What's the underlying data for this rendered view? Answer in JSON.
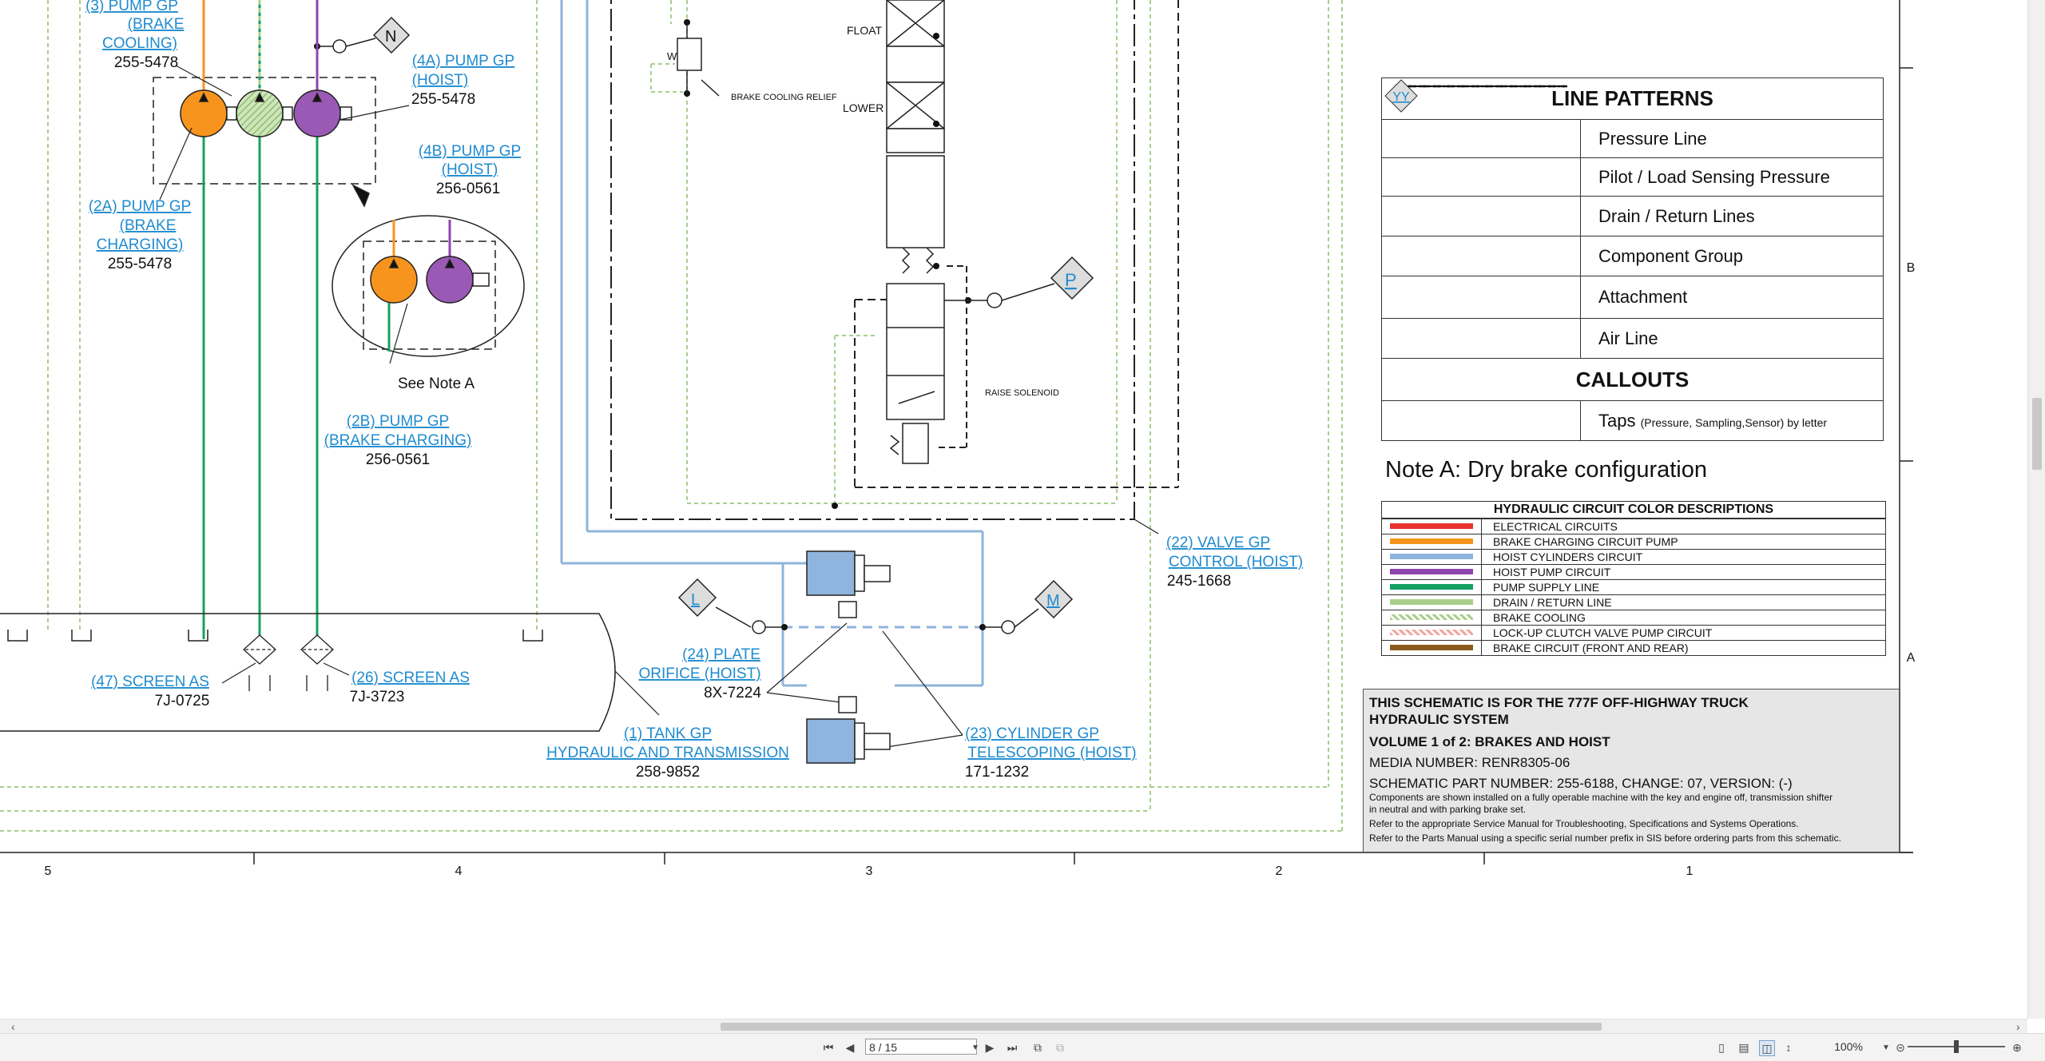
{
  "schematic": {
    "callouts": {
      "pump3": [
        "(3) PUMP GP",
        "(BRAKE",
        "COOLING)"
      ],
      "pump3_pn": "255-5478",
      "pump4a": [
        "(4A) PUMP GP",
        "(HOIST)"
      ],
      "pump4a_pn": "255-5478",
      "pump4b": [
        "(4B) PUMP GP",
        "(HOIST)"
      ],
      "pump4b_pn": "256-0561",
      "pump2a": [
        "(2A) PUMP GP",
        "(BRAKE",
        "CHARGING)"
      ],
      "pump2a_pn": "255-5478",
      "pump2b": [
        "(2B) PUMP GP",
        "(BRAKE CHARGING)"
      ],
      "pump2b_pn": "256-0561",
      "see_note": "See Note A",
      "valve22": [
        "(22) VALVE GP",
        "CONTROL (HOIST)"
      ],
      "valve22_pn": "245-1668",
      "plate24": [
        "(24) PLATE",
        "ORIFICE (HOIST)"
      ],
      "plate24_pn": "8X-7224",
      "screen47": "(47) SCREEN AS",
      "screen47_pn": "7J-0725",
      "screen26": "(26) SCREEN AS",
      "screen26_pn": "7J-3723",
      "tank1": [
        "(1) TANK GP",
        "HYDRAULIC AND TRANSMISSION"
      ],
      "tank1_pn": "258-9852",
      "cyl23": [
        "(23) CYLINDER GP",
        "TELESCOPING (HOIST)"
      ],
      "cyl23_pn": "171-1232",
      "float": "FLOAT",
      "lower": "LOWER",
      "brake_cooling_relief": "BRAKE COOLING RELIEF",
      "raise_solenoid": "RAISE SOLENOID",
      "w": "W",
      "tap_n": "N",
      "tap_p": "P",
      "tap_l": "L",
      "tap_m": "M"
    },
    "grid_columns": [
      "5",
      "4",
      "3",
      "2",
      "1"
    ],
    "grid_rows": [
      "B",
      "A"
    ]
  },
  "legend": {
    "line_patterns_title": "LINE PATTERNS",
    "patterns": [
      {
        "label": "Pressure Line",
        "style": "solid"
      },
      {
        "label": "Pilot / Load Sensing Pressure",
        "style": "dashed"
      },
      {
        "label": "Drain / Return Lines",
        "style": "dotted"
      },
      {
        "label": "Component Group",
        "style": "dash-dot"
      },
      {
        "label": "Attachment",
        "style": "long-dash"
      },
      {
        "label": "Air Line",
        "style": "fine-dash"
      }
    ],
    "callouts_title": "CALLOUTS",
    "tap_symbol": "YY",
    "tap_label": "Taps",
    "tap_sub": "(Pressure, Sampling,Sensor) by letter",
    "note_a": "Note A: Dry brake configuration",
    "color_title": "HYDRAULIC CIRCUIT COLOR DESCRIPTIONS",
    "colors": [
      {
        "label": "ELECTRICAL CIRCUITS",
        "color": "#e8322d",
        "style": "solid"
      },
      {
        "label": "BRAKE CHARGING CIRCUIT PUMP",
        "color": "#f7941d",
        "style": "solid"
      },
      {
        "label": "HOIST CYLINDERS CIRCUIT",
        "color": "#8fb4dd",
        "style": "solid"
      },
      {
        "label": "HOIST PUMP CIRCUIT",
        "color": "#8e44ad",
        "style": "solid"
      },
      {
        "label": "PUMP SUPPLY LINE",
        "color": "#16a163",
        "style": "solid"
      },
      {
        "label": "DRAIN / RETURN LINE",
        "color": "#a9cf8c",
        "style": "solid"
      },
      {
        "label": "BRAKE COOLING",
        "color": "#a9cf8c",
        "style": "hatch-green"
      },
      {
        "label": "LOCK-UP CLUTCH VALVE PUMP CIRCUIT",
        "color": "#f2a6a0",
        "style": "hatch-red"
      },
      {
        "label": "BRAKE CIRCUIT (FRONT AND REAR)",
        "color": "#8b5a1c",
        "style": "solid"
      }
    ]
  },
  "title_block": {
    "line1": "THIS SCHEMATIC IS FOR THE 777F OFF-HIGHWAY TRUCK",
    "line2": "HYDRAULIC SYSTEM",
    "volume": "VOLUME 1 of 2: BRAKES AND HOIST",
    "media": "MEDIA NUMBER: RENR8305-06",
    "part": "SCHEMATIC PART NUMBER: 255-6188, CHANGE: 07, VERSION: (-)",
    "note1": "Components are shown installed on a fully operable machine with the key and engine off, transmission shifter",
    "note2": "in neutral and with parking brake set.",
    "note3": "Refer to the appropriate Service Manual for Troubleshooting, Specifications and Systems Operations.",
    "note4": "Refer to the Parts Manual using a specific serial number prefix in SIS before ordering parts from this schematic."
  },
  "viewer": {
    "page_value": "8 / 15",
    "zoom_value": "100%",
    "zoom_level_fraction": 0.5,
    "vscroll_fraction": 0.42,
    "hscroll_fraction": 0.55
  }
}
